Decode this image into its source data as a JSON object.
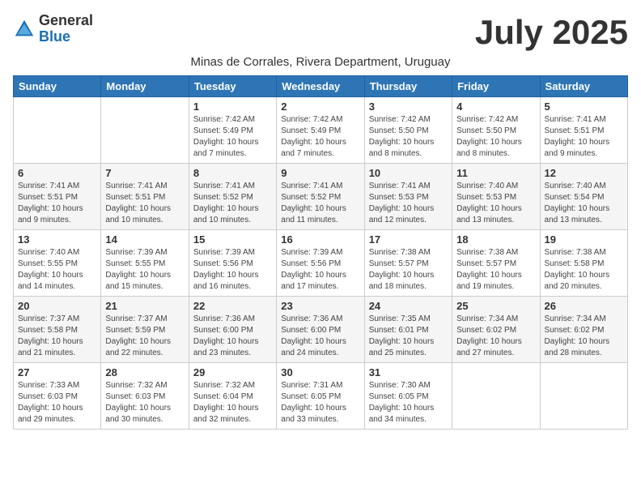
{
  "header": {
    "logo_general": "General",
    "logo_blue": "Blue",
    "month_title": "July 2025",
    "subtitle": "Minas de Corrales, Rivera Department, Uruguay"
  },
  "days_of_week": [
    "Sunday",
    "Monday",
    "Tuesday",
    "Wednesday",
    "Thursday",
    "Friday",
    "Saturday"
  ],
  "weeks": [
    [
      {
        "day": "",
        "info": ""
      },
      {
        "day": "",
        "info": ""
      },
      {
        "day": "1",
        "info": "Sunrise: 7:42 AM\nSunset: 5:49 PM\nDaylight: 10 hours\nand 7 minutes."
      },
      {
        "day": "2",
        "info": "Sunrise: 7:42 AM\nSunset: 5:49 PM\nDaylight: 10 hours\nand 7 minutes."
      },
      {
        "day": "3",
        "info": "Sunrise: 7:42 AM\nSunset: 5:50 PM\nDaylight: 10 hours\nand 8 minutes."
      },
      {
        "day": "4",
        "info": "Sunrise: 7:42 AM\nSunset: 5:50 PM\nDaylight: 10 hours\nand 8 minutes."
      },
      {
        "day": "5",
        "info": "Sunrise: 7:41 AM\nSunset: 5:51 PM\nDaylight: 10 hours\nand 9 minutes."
      }
    ],
    [
      {
        "day": "6",
        "info": "Sunrise: 7:41 AM\nSunset: 5:51 PM\nDaylight: 10 hours\nand 9 minutes."
      },
      {
        "day": "7",
        "info": "Sunrise: 7:41 AM\nSunset: 5:51 PM\nDaylight: 10 hours\nand 10 minutes."
      },
      {
        "day": "8",
        "info": "Sunrise: 7:41 AM\nSunset: 5:52 PM\nDaylight: 10 hours\nand 10 minutes."
      },
      {
        "day": "9",
        "info": "Sunrise: 7:41 AM\nSunset: 5:52 PM\nDaylight: 10 hours\nand 11 minutes."
      },
      {
        "day": "10",
        "info": "Sunrise: 7:41 AM\nSunset: 5:53 PM\nDaylight: 10 hours\nand 12 minutes."
      },
      {
        "day": "11",
        "info": "Sunrise: 7:40 AM\nSunset: 5:53 PM\nDaylight: 10 hours\nand 13 minutes."
      },
      {
        "day": "12",
        "info": "Sunrise: 7:40 AM\nSunset: 5:54 PM\nDaylight: 10 hours\nand 13 minutes."
      }
    ],
    [
      {
        "day": "13",
        "info": "Sunrise: 7:40 AM\nSunset: 5:55 PM\nDaylight: 10 hours\nand 14 minutes."
      },
      {
        "day": "14",
        "info": "Sunrise: 7:39 AM\nSunset: 5:55 PM\nDaylight: 10 hours\nand 15 minutes."
      },
      {
        "day": "15",
        "info": "Sunrise: 7:39 AM\nSunset: 5:56 PM\nDaylight: 10 hours\nand 16 minutes."
      },
      {
        "day": "16",
        "info": "Sunrise: 7:39 AM\nSunset: 5:56 PM\nDaylight: 10 hours\nand 17 minutes."
      },
      {
        "day": "17",
        "info": "Sunrise: 7:38 AM\nSunset: 5:57 PM\nDaylight: 10 hours\nand 18 minutes."
      },
      {
        "day": "18",
        "info": "Sunrise: 7:38 AM\nSunset: 5:57 PM\nDaylight: 10 hours\nand 19 minutes."
      },
      {
        "day": "19",
        "info": "Sunrise: 7:38 AM\nSunset: 5:58 PM\nDaylight: 10 hours\nand 20 minutes."
      }
    ],
    [
      {
        "day": "20",
        "info": "Sunrise: 7:37 AM\nSunset: 5:58 PM\nDaylight: 10 hours\nand 21 minutes."
      },
      {
        "day": "21",
        "info": "Sunrise: 7:37 AM\nSunset: 5:59 PM\nDaylight: 10 hours\nand 22 minutes."
      },
      {
        "day": "22",
        "info": "Sunrise: 7:36 AM\nSunset: 6:00 PM\nDaylight: 10 hours\nand 23 minutes."
      },
      {
        "day": "23",
        "info": "Sunrise: 7:36 AM\nSunset: 6:00 PM\nDaylight: 10 hours\nand 24 minutes."
      },
      {
        "day": "24",
        "info": "Sunrise: 7:35 AM\nSunset: 6:01 PM\nDaylight: 10 hours\nand 25 minutes."
      },
      {
        "day": "25",
        "info": "Sunrise: 7:34 AM\nSunset: 6:02 PM\nDaylight: 10 hours\nand 27 minutes."
      },
      {
        "day": "26",
        "info": "Sunrise: 7:34 AM\nSunset: 6:02 PM\nDaylight: 10 hours\nand 28 minutes."
      }
    ],
    [
      {
        "day": "27",
        "info": "Sunrise: 7:33 AM\nSunset: 6:03 PM\nDaylight: 10 hours\nand 29 minutes."
      },
      {
        "day": "28",
        "info": "Sunrise: 7:32 AM\nSunset: 6:03 PM\nDaylight: 10 hours\nand 30 minutes."
      },
      {
        "day": "29",
        "info": "Sunrise: 7:32 AM\nSunset: 6:04 PM\nDaylight: 10 hours\nand 32 minutes."
      },
      {
        "day": "30",
        "info": "Sunrise: 7:31 AM\nSunset: 6:05 PM\nDaylight: 10 hours\nand 33 minutes."
      },
      {
        "day": "31",
        "info": "Sunrise: 7:30 AM\nSunset: 6:05 PM\nDaylight: 10 hours\nand 34 minutes."
      },
      {
        "day": "",
        "info": ""
      },
      {
        "day": "",
        "info": ""
      }
    ]
  ]
}
